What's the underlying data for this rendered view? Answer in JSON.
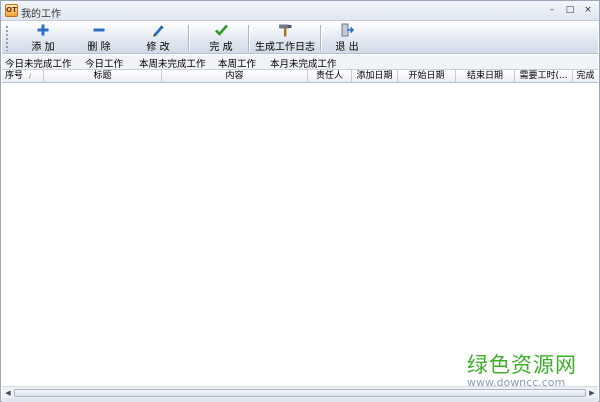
{
  "window": {
    "icon_text": "OT",
    "title": "我的工作",
    "controls": {
      "minimize": "–",
      "maximize": "□",
      "close": "×"
    }
  },
  "toolbar": {
    "add": "添 加",
    "delete": "删 除",
    "edit": "修 改",
    "complete": "完 成",
    "generate_log": "生成工作日志",
    "exit": "退 出"
  },
  "tabs": [
    "今日未完成工作",
    "今日工作",
    "本周未完成工作",
    "本周工作",
    "本月未完成工作"
  ],
  "columns": [
    "序号",
    "标题",
    "内容",
    "责任人",
    "添加日期",
    "开始日期",
    "结束日期",
    "需要工时(...",
    "完成"
  ],
  "sort_indicator": "/",
  "colors": {
    "accent": "#2a6fc4",
    "check": "#2f9a2f",
    "watermark": "#3fae2a"
  },
  "watermark": {
    "title": "绿色资源网",
    "url": "www.downcc.com"
  }
}
